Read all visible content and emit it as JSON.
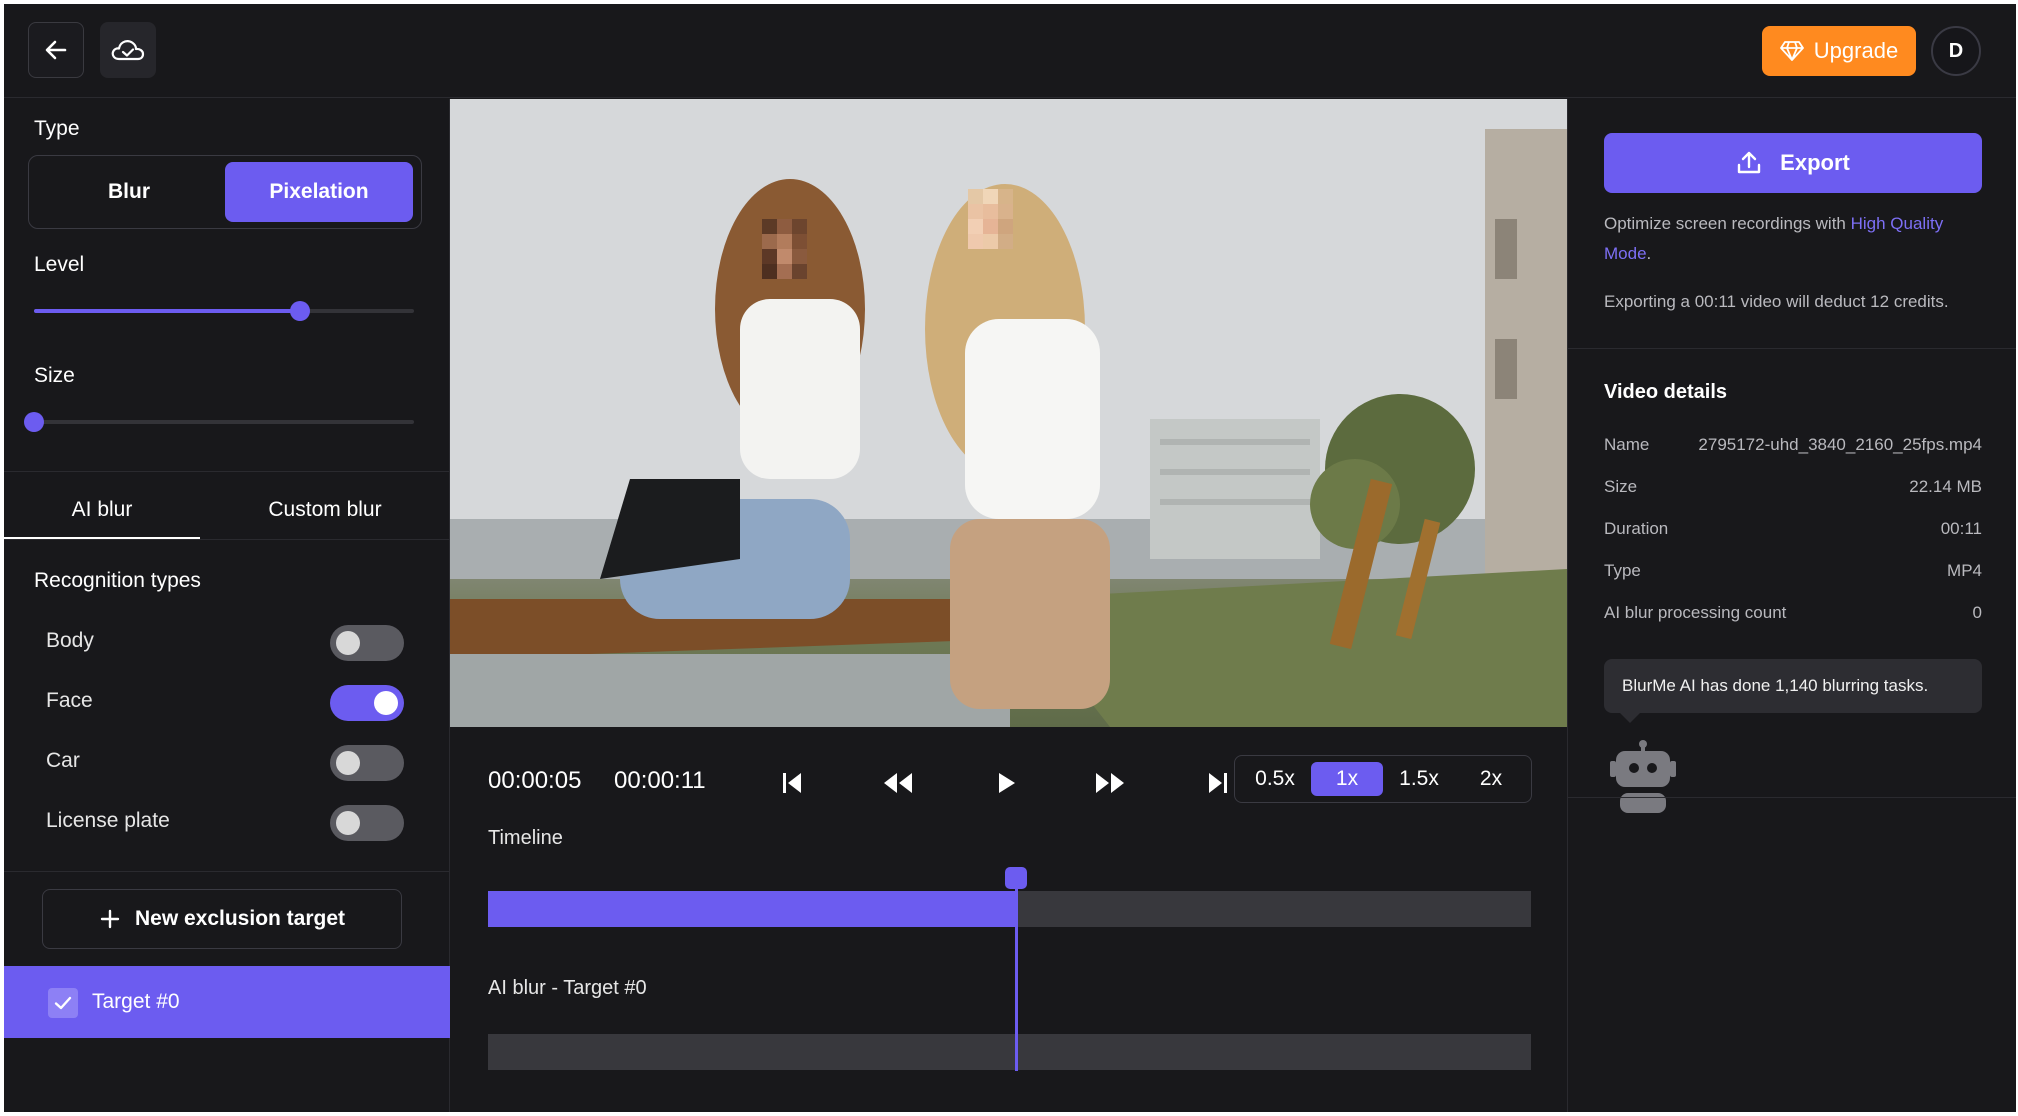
{
  "topbar": {
    "upgrade_label": "Upgrade",
    "avatar_initial": "D"
  },
  "left": {
    "type_label": "Type",
    "type_options": [
      "Blur",
      "Pixelation"
    ],
    "type_selected": "Pixelation",
    "level_label": "Level",
    "level_value": 0.7,
    "size_label": "Size",
    "size_value": 0.0,
    "tabs": [
      "AI blur",
      "Custom blur"
    ],
    "active_tab": "AI blur",
    "recognition_title": "Recognition types",
    "recognition": [
      {
        "label": "Body",
        "on": false
      },
      {
        "label": "Face",
        "on": true
      },
      {
        "label": "Car",
        "on": false
      },
      {
        "label": "License plate",
        "on": false
      }
    ],
    "new_exclusion_label": "New exclusion target",
    "target_label": "Target #0",
    "target_checked": true
  },
  "player": {
    "current_time": "00:00:05",
    "total_time": "00:00:11",
    "speeds": [
      "0.5x",
      "1x",
      "1.5x",
      "2x"
    ],
    "active_speed": "1x",
    "progress": 0.506,
    "timeline_label": "Timeline",
    "track_label": "AI blur - Target #0"
  },
  "right": {
    "export_label": "Export",
    "hint_prefix": "Optimize screen recordings with ",
    "hint_link": "High Quality Mode",
    "hint_suffix": ".",
    "credits_note": "Exporting a 00:11 video will deduct 12 credits.",
    "video_details_title": "Video details",
    "details": [
      {
        "key": "Name",
        "value": "2795172-uhd_3840_2160_25fps.mp4"
      },
      {
        "key": "Size",
        "value": "22.14 MB"
      },
      {
        "key": "Duration",
        "value": "00:11"
      },
      {
        "key": "Type",
        "value": "MP4"
      },
      {
        "key": "AI blur processing count",
        "value": "0"
      }
    ],
    "tooltip": "BlurMe AI has done 1,140 blurring tasks."
  },
  "colors": {
    "accent": "#6c5cf0",
    "upgrade": "#ff8a1f",
    "background": "#18181b"
  },
  "icons": [
    "back-arrow-icon",
    "cloud-icon",
    "diamond-icon",
    "plus-icon",
    "check-icon",
    "skip-start-icon",
    "rewind-icon",
    "play-icon",
    "fast-forward-icon",
    "skip-end-icon",
    "upload-icon",
    "robot-icon"
  ]
}
